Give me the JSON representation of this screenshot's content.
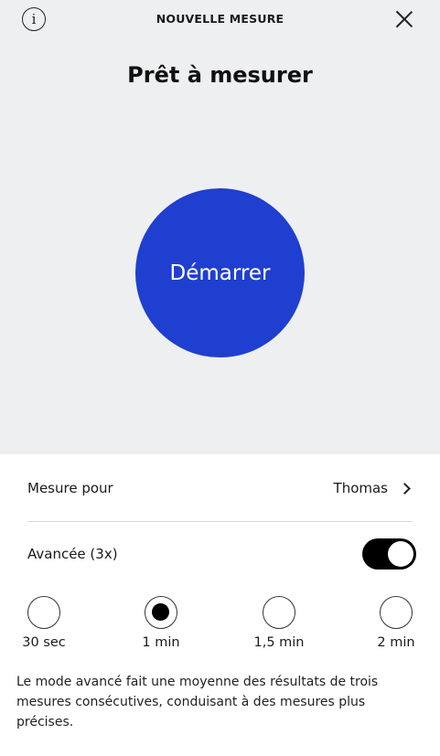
{
  "header": {
    "title": "NOUVELLE MESURE",
    "info_icon": "info-icon",
    "close_icon": "close-icon"
  },
  "main": {
    "title": "Prêt à mesurer",
    "start_label": "Démarrer",
    "start_color": "#1f3fd0"
  },
  "measure_for": {
    "label": "Mesure pour",
    "value": "Thomas",
    "icon": "chevron-right-icon"
  },
  "advanced": {
    "label": "Avancée (3x)",
    "enabled": true
  },
  "durations": {
    "options": [
      "30 sec",
      "1 min",
      "1,5 min",
      "2 min"
    ],
    "selected": "1 min"
  },
  "description": "Le mode avancé fait une moyenne des résultats de trois mesures consécutives, conduisant à des mesures plus précises."
}
